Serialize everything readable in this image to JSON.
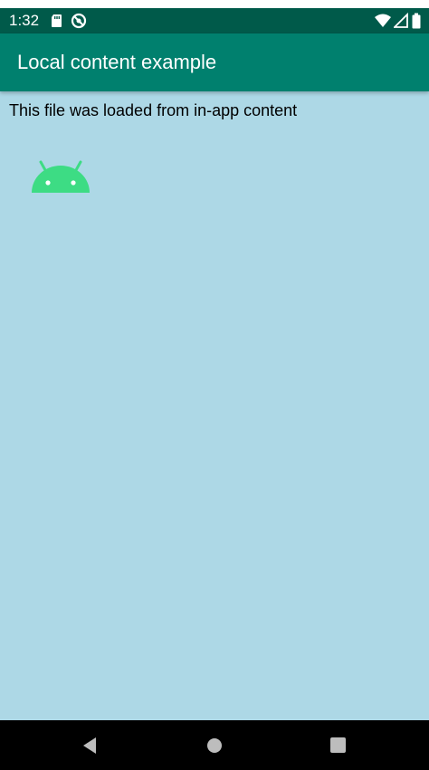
{
  "status_bar": {
    "time": "1:32",
    "icons_left": [
      "sd-card-icon",
      "data-saver-icon"
    ],
    "icons_right": [
      "wifi-icon",
      "signal-icon",
      "battery-icon"
    ]
  },
  "app_bar": {
    "title": "Local content example"
  },
  "content": {
    "message": "This file was loaded from in-app content",
    "image": "android-logo",
    "background_color": "#add8e6"
  },
  "nav_bar": {
    "buttons": [
      "back-button",
      "home-button",
      "recents-button"
    ]
  },
  "colors": {
    "status_bar": "#005a4a",
    "app_bar": "#00806e",
    "android_green": "#3ddc84"
  }
}
